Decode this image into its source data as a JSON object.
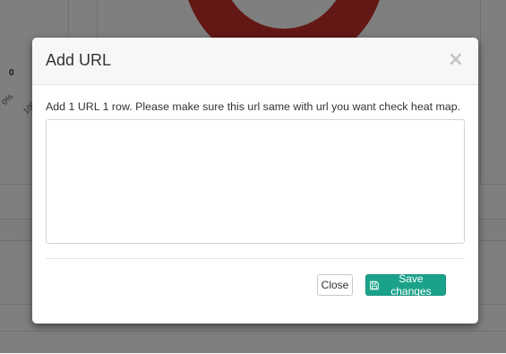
{
  "background": {
    "axis_zero": "0",
    "axis_ticks": [
      "0%",
      "100"
    ],
    "donut_color": "#c9302c"
  },
  "modal": {
    "title": "Add URL",
    "close_icon": "×",
    "instructions": "Add 1 URL 1 row. Please make sure this url same with url you want check heat map.",
    "textarea_value": "",
    "close_button_label": "Close",
    "save_button_label": "Save changes",
    "save_button_icon": "floppy-disk-icon",
    "accent_color": "#1aa38a"
  }
}
